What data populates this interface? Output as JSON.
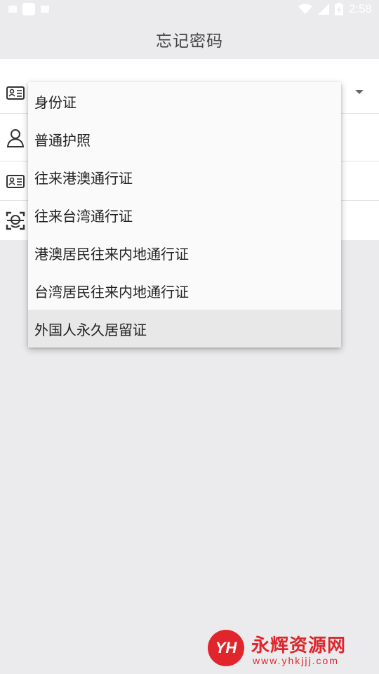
{
  "status_bar": {
    "time": "2:58",
    "left_icons": [
      "keyboard-icon",
      "square-icon",
      "app-a-icon"
    ],
    "right_icons": [
      "wifi-icon",
      "signal-icon",
      "battery-icon"
    ]
  },
  "header": {
    "title": "忘记密码"
  },
  "form": {
    "rows": [
      {
        "icon": "id-card-icon",
        "has_dropdown": true
      },
      {
        "icon": "person-icon"
      },
      {
        "icon": "id-card-icon"
      },
      {
        "icon": "face-scan-icon"
      }
    ]
  },
  "dropdown_menu": {
    "items": [
      {
        "label": "身份证"
      },
      {
        "label": "普通护照"
      },
      {
        "label": "往来港澳通行证"
      },
      {
        "label": "往来台湾通行证"
      },
      {
        "label": "港澳居民往来内地通行证"
      },
      {
        "label": "台湾居民往来内地通行证"
      },
      {
        "label": "外国人永久居留证",
        "selected": true
      }
    ]
  },
  "watermark": {
    "logo_text": "YH",
    "name": "永辉资源网",
    "url": "www.yhkjjj.com",
    "color": "#e0262c"
  },
  "colors": {
    "background": "#ebebed",
    "surface": "#ffffff",
    "menu_background": "#fafafa",
    "selected_item": "#e8e8e8"
  }
}
